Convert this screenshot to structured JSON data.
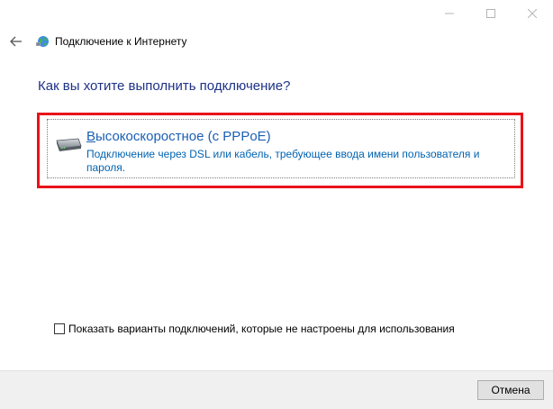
{
  "window": {
    "title": "Подключение к Интернету",
    "controls": [
      "minimize-icon",
      "maximize-icon",
      "close-icon"
    ]
  },
  "question": "Как вы хотите выполнить подключение?",
  "option": {
    "title_access_key": "В",
    "title_rest": "ысокоскоростное (с PPPoE)",
    "description": "Подключение через DSL или кабель, требующее ввода имени пользователя и пароля.",
    "icon": "broadband-modem-icon",
    "highlight_color": "#e8131a"
  },
  "checkbox": {
    "checked": false,
    "label": "Показать варианты подключений, которые не настроены для использования"
  },
  "footer": {
    "cancel_label": "Отмена"
  },
  "colors": {
    "heading": "#1e3287",
    "link": "#1a5fb4",
    "description": "#0063b1"
  }
}
